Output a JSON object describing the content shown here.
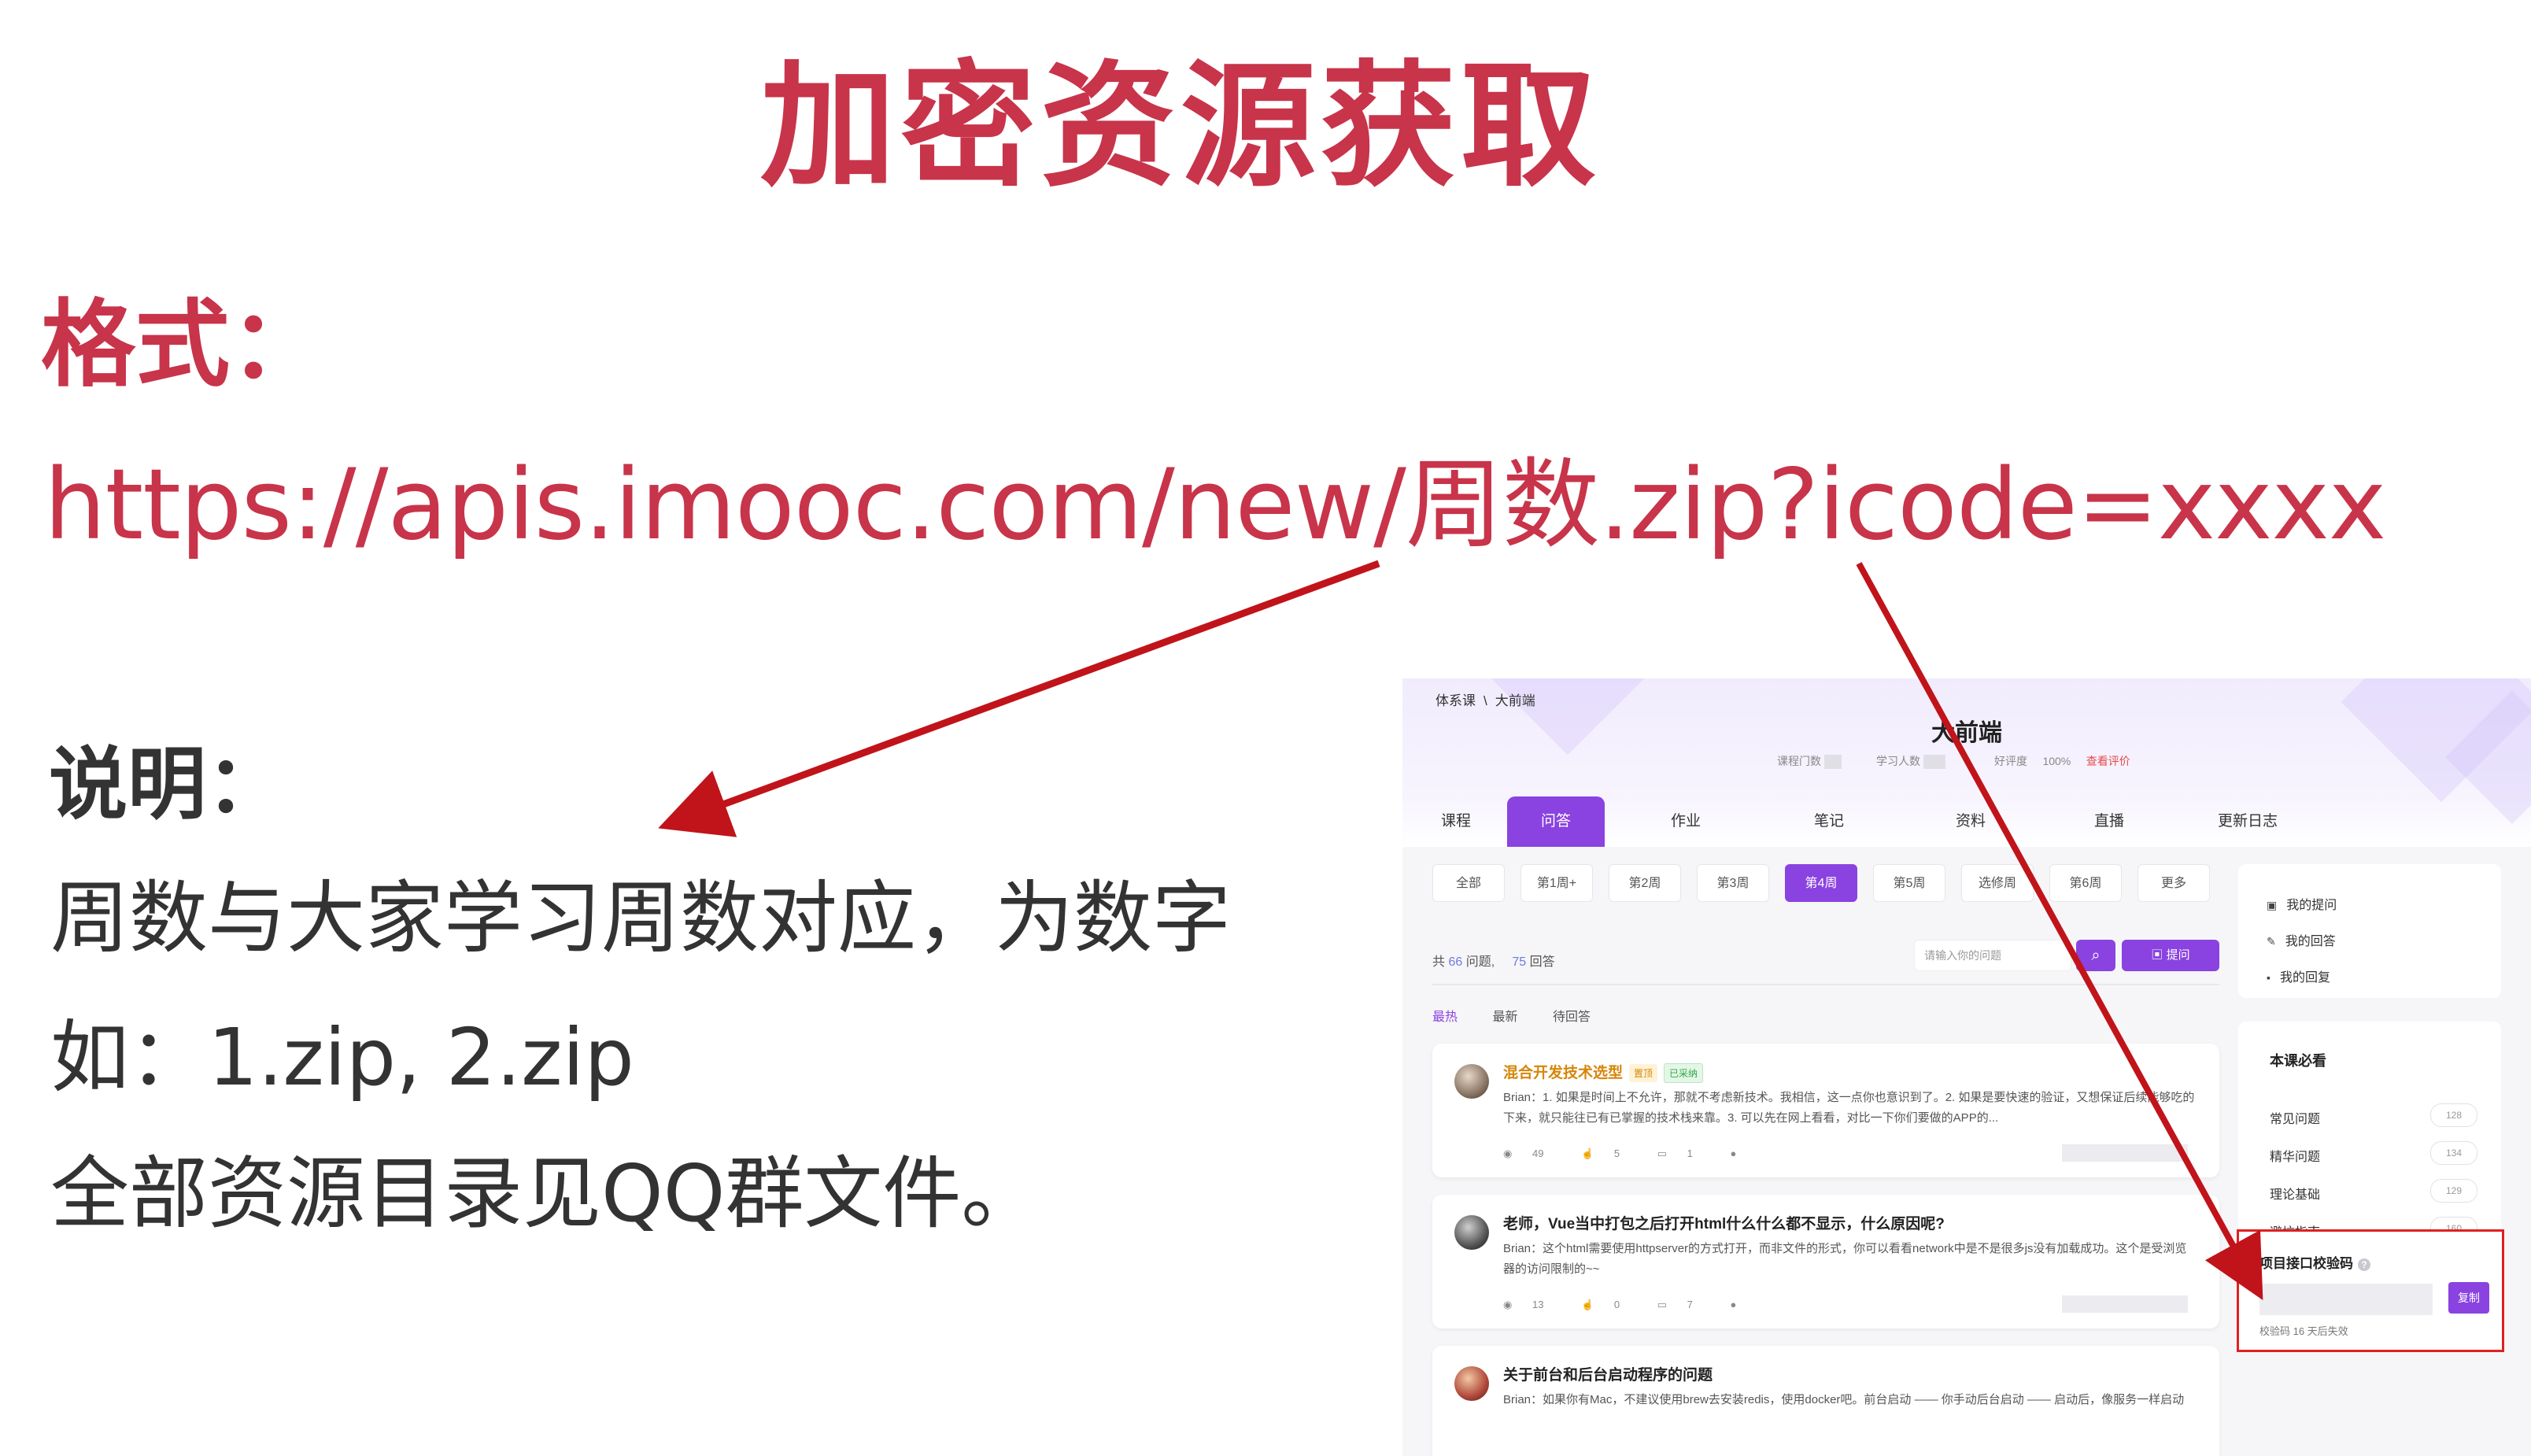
{
  "slide": {
    "title": "加密资源获取",
    "format_heading": "格式：",
    "format_url": "https://apis.imooc.com/new/周数.zip?icode=xxxx",
    "note_heading": "说明：",
    "notes": [
      "周数与大家学习周数对应，为数字",
      "如：1.zip, 2.zip",
      "全部资源目录见QQ群文件。"
    ],
    "title_color": "#c8344a",
    "arrow_color": "#c0141a"
  },
  "screenshot": {
    "breadcrumb": [
      "体系课",
      "\\",
      "大前端"
    ],
    "course_name": "大前端",
    "stats": {
      "courses_label": "课程门数",
      "students_label": "学习人数",
      "rating_label": "好评度",
      "rating_value": "100%",
      "review_link": "查看评价"
    },
    "tabs": [
      "课程",
      "问答",
      "作业",
      "笔记",
      "资料",
      "直播",
      "更新日志"
    ],
    "active_tab": "问答",
    "weeks": [
      "全部",
      "第1周+",
      "第2周",
      "第3周",
      "第4周",
      "第5周",
      "选修周",
      "第6周",
      "更多"
    ],
    "active_week": "第4周",
    "counts": {
      "prefix": "共",
      "questions": "66",
      "questions_label": "问题,",
      "answers": "75",
      "answers_label": "回答"
    },
    "search_placeholder": "请输入你的问题",
    "ask_label": "提问",
    "sort": [
      "最热",
      "最新",
      "待回答"
    ],
    "questions": [
      {
        "title": "混合开发技术选型",
        "tag_top": "置顶",
        "tag_accepted": "已采纳",
        "body": "Brian：1. 如果是时间上不允许，那就不考虑新技术。我相信，这一点你也意识到了。2. 如果是要快速的验证，又想保证后续能够吃的下来，就只能往已有已掌握的技术栈来靠。3. 可以先在网上看看，对比一下你们要做的APP的...",
        "views": "49",
        "likes": "5",
        "comments": "1"
      },
      {
        "title": "老师，Vue当中打包之后打开html什么什么都不显示，什么原因呢?",
        "body": "Brian：这个html需要使用httpserver的方式打开，而非文件的形式，你可以看看network中是不是很多js没有加载成功。这个是受浏览器的访问限制的~~",
        "views": "13",
        "likes": "0",
        "comments": "7"
      },
      {
        "title": "关于前台和后台启动程序的问题",
        "body": "Brian：如果你有Mac，不建议使用brew去安装redis，使用docker吧。前台启动 —— 你手动后台启动 —— 启动后，像服务一样启动"
      }
    ],
    "sidebar": {
      "links": [
        "我的提问",
        "我的回答",
        "我的回复"
      ],
      "must_read_heading": "本课必看",
      "must_read": [
        {
          "label": "常见问题",
          "count": "128"
        },
        {
          "label": "精华问题",
          "count": "134"
        },
        {
          "label": "理论基础",
          "count": "129"
        },
        {
          "label": "避坑指南",
          "count": "160"
        }
      ],
      "code_title": "项目接口校验码",
      "copy_label": "复制",
      "code_note": "校验码 16 天后失效"
    },
    "accent_color": "#8a43e0",
    "highlight_color": "#e02020"
  }
}
